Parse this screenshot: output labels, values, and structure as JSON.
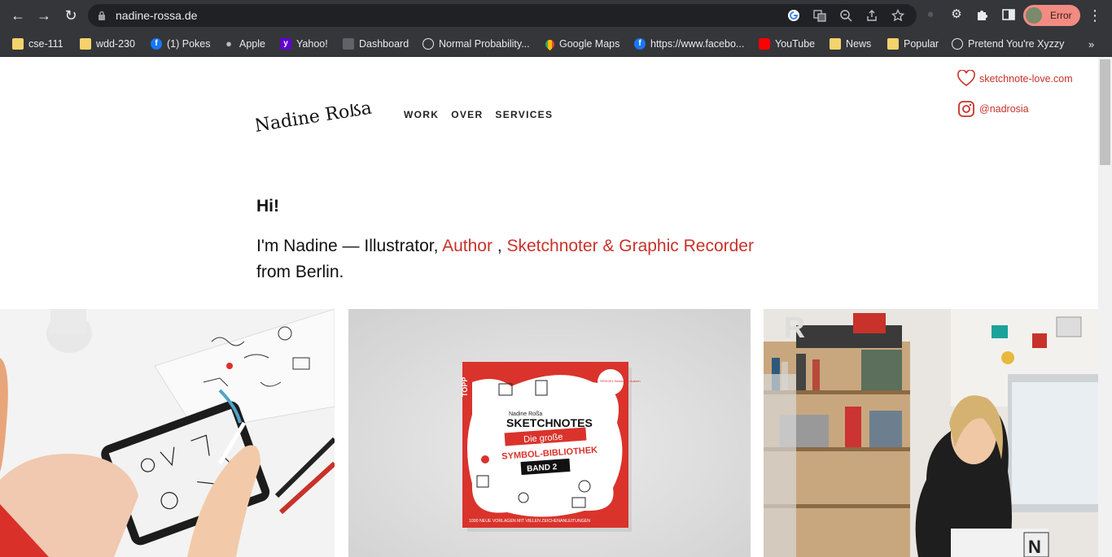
{
  "browser": {
    "url": "nadine-rossa.de",
    "profile_label": "Error",
    "bookmarks": [
      {
        "label": "cse-111",
        "icon": "folder-icon"
      },
      {
        "label": "wdd-230",
        "icon": "folder-icon"
      },
      {
        "label": "(1) Pokes",
        "icon": "facebook-icon"
      },
      {
        "label": "Apple",
        "icon": "apple-icon"
      },
      {
        "label": "Yahoo!",
        "icon": "yahoo-icon"
      },
      {
        "label": "Dashboard",
        "icon": "dashboard-icon"
      },
      {
        "label": "Normal Probability...",
        "icon": "globe-icon"
      },
      {
        "label": "Google Maps",
        "icon": "maps-icon"
      },
      {
        "label": "https://www.facebo...",
        "icon": "facebook-icon"
      },
      {
        "label": "YouTube",
        "icon": "youtube-icon"
      },
      {
        "label": "News",
        "icon": "folder-icon"
      },
      {
        "label": "Popular",
        "icon": "folder-icon"
      },
      {
        "label": "Pretend You're Xyzzy",
        "icon": "globe-icon"
      }
    ]
  },
  "site": {
    "logo": "Nadine Roßa",
    "nav": [
      "WORK",
      "OVER",
      "SERVICES"
    ],
    "social": [
      {
        "label": "sketchnote-love.com",
        "icon": "heart-icon"
      },
      {
        "label": "@nadrosia",
        "icon": "instagram-icon"
      }
    ],
    "greeting": "Hi!",
    "intro": {
      "prefix": "I'm Nadine — Illustrator, ",
      "link1": "Author",
      "sep": " , ",
      "link2": "Sketchnoter & Graphic Recorder",
      "suffix": "from Berlin."
    },
    "book": {
      "publisher": "TOPP",
      "author": "Nadine Roßa",
      "title": "SKETCHNOTES",
      "subtitle1": "Die große",
      "subtitle2": "SYMBOL-BIBLIOTHEK",
      "band": "BAND 2",
      "tagline_pre": "1000 ",
      "tagline_neue": "NEUE",
      "tagline_post": " VORLAGEN MIT VIELEN ZEICHENANLEITUNGEN",
      "badge": "SPIEGEL Bestseller-Autorin"
    },
    "colors": {
      "accent": "#c8322a",
      "text": "#111111"
    }
  }
}
